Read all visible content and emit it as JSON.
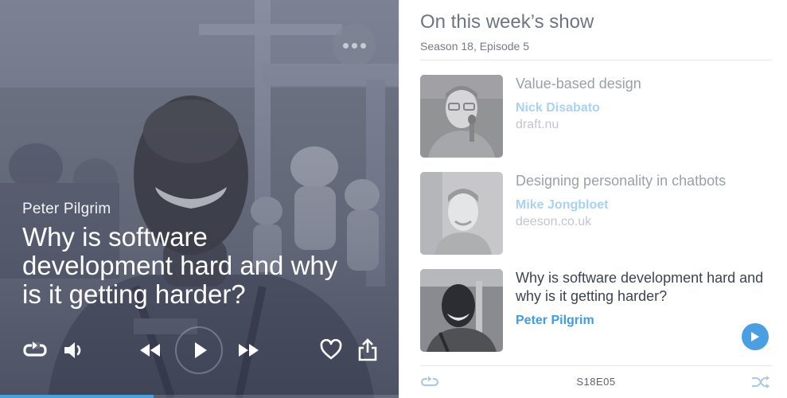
{
  "player": {
    "speaker": "Peter Pilgrim",
    "title": "Why is software development hard and why is it getting harder?",
    "progress": 0.385,
    "icons": {
      "more": "more-horizontal-icon",
      "repeat": "repeat-icon",
      "volume": "volume-icon",
      "rewind": "rewind-icon",
      "play": "play-icon",
      "fast_forward": "fast-forward-icon",
      "favorite": "heart-icon",
      "share": "share-icon"
    }
  },
  "panel": {
    "title": "On this week’s show",
    "subtitle": "Season 18, Episode 5",
    "episodes": [
      {
        "title": "Value-based design",
        "author": "Nick Disabato",
        "site": "draft.nu",
        "active": false
      },
      {
        "title": "Designing personality in chatbots",
        "author": "Mike Jongbloet",
        "site": "deeson.co.uk",
        "active": false
      },
      {
        "title": "Why is software development hard and why is it getting harder?",
        "author": "Peter Pilgrim",
        "site": "",
        "active": true
      }
    ],
    "footer": {
      "code": "S18E05"
    }
  },
  "colors": {
    "accent": "#4a9fe3",
    "accent_light": "#a8d2f3"
  }
}
